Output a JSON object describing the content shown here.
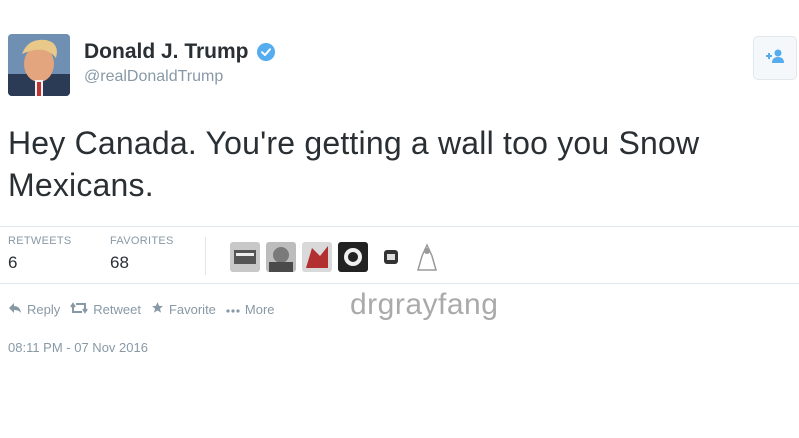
{
  "tweet": {
    "display_name": "Donald J. Trump",
    "handle": "@realDonaldTrump",
    "text": "Hey Canada. You're getting a wall too you Snow Mexicans.",
    "timestamp": "08:11 PM - 07 Nov 2016"
  },
  "icons": {
    "verified": "verified-badge-icon",
    "follow": "follow-user-icon",
    "reply": "reply-arrow-icon",
    "retweet": "retweet-arrows-icon",
    "favorite": "star-icon",
    "more": "ellipsis-icon"
  },
  "stats": {
    "retweets_label": "RETWEETS",
    "retweets_value": "6",
    "favorites_label": "FAVORITES",
    "favorites_value": "68"
  },
  "actions": {
    "reply": "Reply",
    "retweet": "Retweet",
    "favorite": "Favorite",
    "more": "More"
  },
  "watermark": "drgrayfang",
  "colors": {
    "accent": "#55acee",
    "text": "#292f33",
    "muted": "#8899a6",
    "border": "#e1e8ed"
  }
}
